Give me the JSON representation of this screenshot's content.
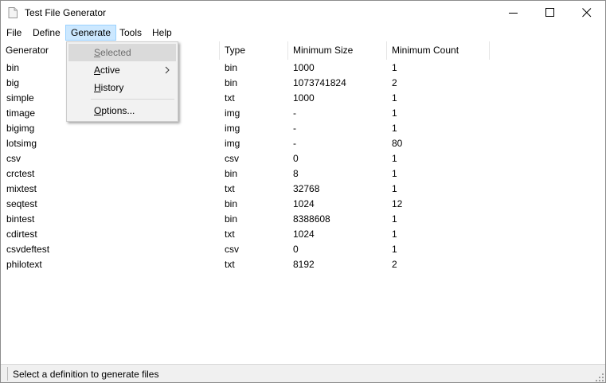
{
  "window": {
    "title": "Test File Generator",
    "icon": "file-icon"
  },
  "menubar": {
    "items": [
      {
        "label": "File"
      },
      {
        "label": "Define"
      },
      {
        "label": "Generate"
      },
      {
        "label": "Tools"
      },
      {
        "label": "Help"
      }
    ]
  },
  "generate_menu": {
    "items": [
      {
        "label": "Selected",
        "mnemonic": "S",
        "rest": "elected",
        "enabled": false
      },
      {
        "label": "Active",
        "mnemonic": "A",
        "rest": "ctive",
        "submenu": true
      },
      {
        "label": "History",
        "mnemonic": "H",
        "rest": "istory"
      },
      {
        "label": "Options...",
        "mnemonic": "O",
        "rest": "ptions..."
      }
    ]
  },
  "table": {
    "columns": [
      "Generator",
      "Type",
      "Minimum Size",
      "Minimum Count"
    ],
    "rows": [
      [
        "bin",
        "bin",
        "1000",
        "1"
      ],
      [
        "big",
        "bin",
        "1073741824",
        "2"
      ],
      [
        "simple",
        "txt",
        "1000",
        "1"
      ],
      [
        "timage",
        "img",
        "-",
        "1"
      ],
      [
        "bigimg",
        "img",
        "-",
        "1"
      ],
      [
        "lotsimg",
        "img",
        "-",
        "80"
      ],
      [
        "csv",
        "csv",
        "0",
        "1"
      ],
      [
        "crctest",
        "bin",
        "8",
        "1"
      ],
      [
        "mixtest",
        "txt",
        "32768",
        "1"
      ],
      [
        "seqtest",
        "bin",
        "1024",
        "12"
      ],
      [
        "bintest",
        "bin",
        "8388608",
        "1"
      ],
      [
        "cdirtest",
        "txt",
        "1024",
        "1"
      ],
      [
        "csvdeftest",
        "csv",
        "0",
        "1"
      ],
      [
        "philotext",
        "txt",
        "8192",
        "2"
      ]
    ]
  },
  "statusbar": {
    "text": "Select a definition to generate files"
  },
  "colors": {
    "menu_active_bg": "#cce8ff",
    "dropdown_bg": "#f2f2f2",
    "statusbar_bg": "#f0f0f0"
  }
}
